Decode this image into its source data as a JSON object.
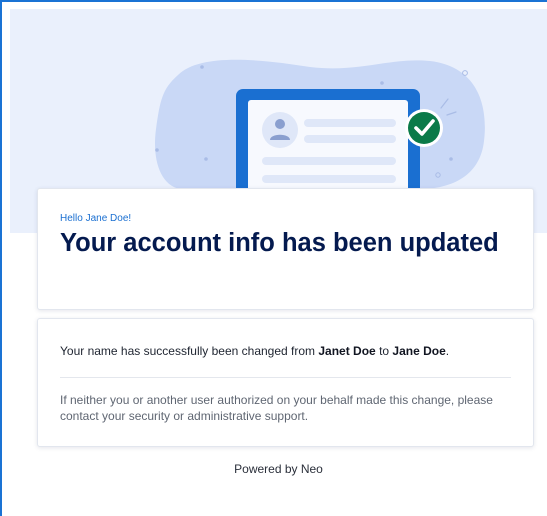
{
  "greeting": "Hello Jane Doe!",
  "headline": "Your account info has been updated",
  "message": {
    "prefix": "Your name has successfully been changed from ",
    "old_name": "Janet Doe",
    "middle": " to ",
    "new_name": "Jane Doe",
    "suffix": "."
  },
  "notice": "If neither you or another user authorized on your behalf made this change, please contact your security or administrative support.",
  "footer": "Powered by Neo",
  "illustration": {
    "icons": [
      "profile-card-illustration",
      "avatar-icon",
      "checkmark-badge-icon"
    ],
    "colors": {
      "hero_background": "#eaf0fc",
      "blob": "#c9d8f6",
      "device_frame": "#1a6fd1",
      "check_badge": "#0a7a48",
      "headline": "#041a4f",
      "link_blue": "#1a6fd1"
    }
  }
}
